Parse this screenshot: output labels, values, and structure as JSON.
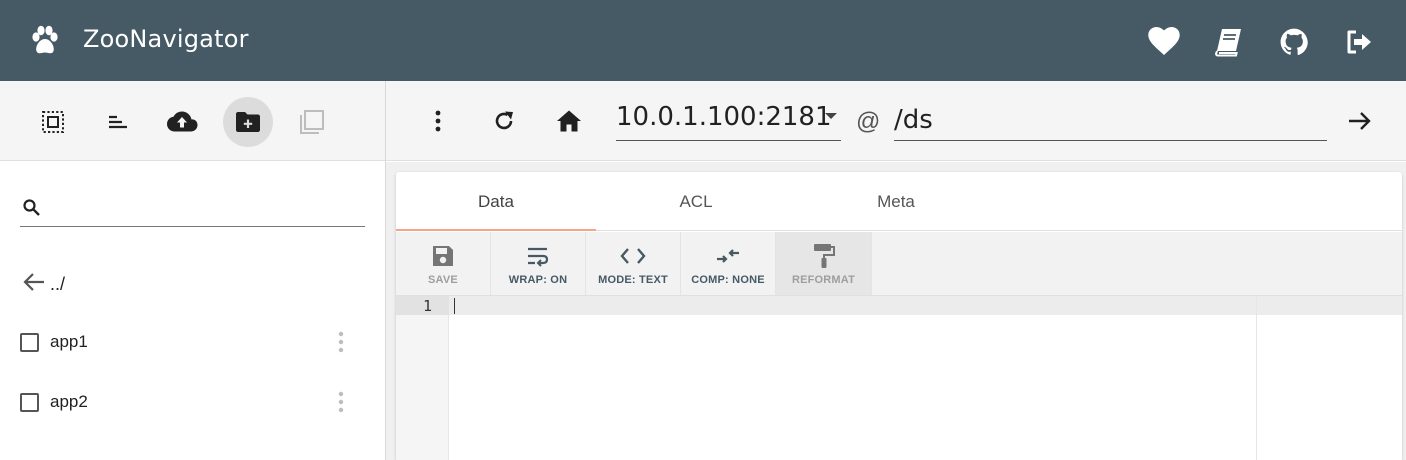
{
  "app": {
    "title": "ZooNavigator",
    "header_actions": [
      "heart-icon",
      "book-icon",
      "github-icon",
      "logout-icon"
    ],
    "colors": {
      "header": "#455a64",
      "tab_ink": "#f4a58a"
    }
  },
  "left_toolbar": {
    "buttons": [
      "select-all-icon",
      "sort-icon",
      "cloud-upload-icon",
      "create-node-icon",
      "duplicate-icon"
    ]
  },
  "right_toolbar": {
    "host": "10.0.1.100:2181",
    "at": "@",
    "path": "/ds"
  },
  "tree": {
    "search": {
      "value": "",
      "placeholder": ""
    },
    "parent": "../",
    "nodes": [
      {
        "name": "app1"
      },
      {
        "name": "app2"
      }
    ]
  },
  "tabs": [
    {
      "label": "Data",
      "active": true
    },
    {
      "label": "ACL",
      "active": false
    },
    {
      "label": "Meta",
      "active": false
    }
  ],
  "editor_toolbar": {
    "save": "SAVE",
    "wrap": "WRAP: ON",
    "mode": "MODE: TEXT",
    "comp": "COMP: NONE",
    "reformat": "REFORMAT"
  },
  "editor": {
    "line_number": "1",
    "content": ""
  }
}
